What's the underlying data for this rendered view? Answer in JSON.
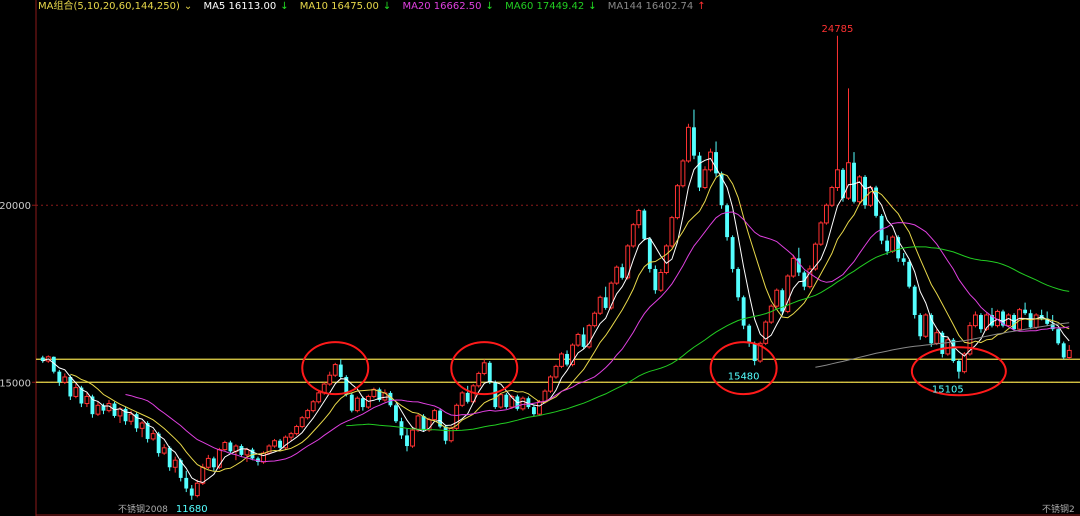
{
  "legend": {
    "group_label": "MA组合(5,10,20,60,144,250)",
    "group_arrow": "⌄",
    "items": [
      {
        "label": "MA5 16113.00",
        "arrow": "↓",
        "color": "#ffffff"
      },
      {
        "label": "MA10 16475.00",
        "arrow": "↓",
        "color": "#e8d84a"
      },
      {
        "label": "MA20 16662.50",
        "arrow": "↓",
        "color": "#e040e0"
      },
      {
        "label": "MA60 17449.42",
        "arrow": "↓",
        "color": "#22cc22"
      },
      {
        "label": "MA144 16402.74",
        "arrow": "↑",
        "color": "#888888"
      }
    ],
    "group_color": "#e8d84a",
    "down_color": "#22dd22",
    "up_color": "#ff3030"
  },
  "colors": {
    "up": "#ff3232",
    "down": "#54ffff",
    "ma5": "#ffffff",
    "ma10": "#e8d84a",
    "ma20": "#e040e0",
    "ma60": "#22cc22",
    "ma144": "#888888",
    "support": "#e8d84a",
    "grid": "#8b1a1a",
    "axis": "#8b1a1a",
    "circle": "#ff1a1a",
    "peak_label": "#ff3232",
    "low_label": "#54ffff"
  },
  "chart_data": {
    "type": "candlestick",
    "y_ticks": [
      15000,
      20000
    ],
    "ylim": [
      11450,
      25400
    ],
    "support_levels": [
      15000,
      15650
    ],
    "annotations": [
      {
        "text": "24785",
        "value": 24785,
        "index": 144,
        "kind": "peak"
      },
      {
        "text": "15480",
        "value": 15480,
        "index": 127,
        "kind": "low"
      },
      {
        "text": "15105",
        "value": 15105,
        "index": 164,
        "kind": "low"
      },
      {
        "text": "11680",
        "value": 11680,
        "index": 27,
        "kind": "low"
      }
    ],
    "circles": [
      {
        "index": 53,
        "value": 15400
      },
      {
        "index": 80,
        "value": 15400
      },
      {
        "index": 127,
        "value": 15400
      },
      {
        "index": 166,
        "value": 15310
      }
    ],
    "bottom_labels": [
      "不锈钢2008",
      "不锈钢2"
    ],
    "ma_labels": [
      "MA5",
      "MA10",
      "MA20",
      "MA60",
      "MA144"
    ],
    "candles": [
      [
        15700,
        15750,
        15550,
        15600
      ],
      [
        15600,
        15760,
        15550,
        15720
      ],
      [
        15720,
        15730,
        15250,
        15300
      ],
      [
        15300,
        15350,
        14900,
        15000
      ],
      [
        15000,
        15250,
        14950,
        15150
      ],
      [
        15150,
        15200,
        14500,
        14600
      ],
      [
        14600,
        14950,
        14550,
        14850
      ],
      [
        14850,
        14900,
        14300,
        14400
      ],
      [
        14400,
        14700,
        14300,
        14600
      ],
      [
        14600,
        14650,
        14000,
        14100
      ],
      [
        14100,
        14450,
        14050,
        14350
      ],
      [
        14350,
        14400,
        14100,
        14200
      ],
      [
        14200,
        14500,
        14150,
        14400
      ],
      [
        14400,
        14450,
        14000,
        14050
      ],
      [
        14050,
        14300,
        13850,
        14250
      ],
      [
        14250,
        14300,
        13800,
        13900
      ],
      [
        13900,
        14200,
        13800,
        14100
      ],
      [
        14100,
        14150,
        13600,
        13700
      ],
      [
        13700,
        13900,
        13450,
        13850
      ],
      [
        13850,
        13900,
        13300,
        13400
      ],
      [
        13400,
        13650,
        13350,
        13550
      ],
      [
        13550,
        13600,
        12900,
        13000
      ],
      [
        13000,
        13250,
        12950,
        13150
      ],
      [
        13150,
        13200,
        12500,
        12600
      ],
      [
        12600,
        12900,
        12450,
        12800
      ],
      [
        12800,
        12850,
        12200,
        12300
      ],
      [
        12300,
        12500,
        11900,
        12000
      ],
      [
        12000,
        12100,
        11680,
        11800
      ],
      [
        11800,
        12250,
        11750,
        12150
      ],
      [
        12150,
        12700,
        12100,
        12600
      ],
      [
        12600,
        12950,
        12550,
        12850
      ],
      [
        12850,
        12900,
        12500,
        12600
      ],
      [
        12600,
        13150,
        12550,
        13100
      ],
      [
        13100,
        13350,
        13050,
        13300
      ],
      [
        13300,
        13350,
        13000,
        13050
      ],
      [
        13050,
        13250,
        12800,
        13200
      ],
      [
        13200,
        13250,
        12900,
        12950
      ],
      [
        12950,
        13150,
        12750,
        13100
      ],
      [
        13100,
        13150,
        12800,
        12850
      ],
      [
        12850,
        12900,
        12650,
        12750
      ],
      [
        12750,
        13050,
        12700,
        13000
      ],
      [
        13000,
        13250,
        12950,
        13200
      ],
      [
        13200,
        13400,
        13150,
        13350
      ],
      [
        13350,
        13400,
        13100,
        13150
      ],
      [
        13150,
        13500,
        13100,
        13450
      ],
      [
        13450,
        13600,
        13350,
        13550
      ],
      [
        13550,
        13800,
        13500,
        13750
      ],
      [
        13750,
        14050,
        13700,
        14000
      ],
      [
        14000,
        14250,
        13950,
        14200
      ],
      [
        14200,
        14500,
        14150,
        14450
      ],
      [
        14450,
        14750,
        14400,
        14700
      ],
      [
        14700,
        15000,
        14650,
        14950
      ],
      [
        14950,
        15300,
        14900,
        15200
      ],
      [
        15200,
        15550,
        15150,
        15500
      ],
      [
        15500,
        15650,
        15100,
        15150
      ],
      [
        15150,
        15200,
        14600,
        14650
      ],
      [
        14650,
        14700,
        14150,
        14200
      ],
      [
        14200,
        14600,
        14150,
        14550
      ],
      [
        14550,
        14600,
        14200,
        14300
      ],
      [
        14300,
        14650,
        14250,
        14600
      ],
      [
        14600,
        14850,
        14550,
        14800
      ],
      [
        14800,
        14850,
        14450,
        14500
      ],
      [
        14500,
        14800,
        14450,
        14700
      ],
      [
        14700,
        14750,
        14300,
        14350
      ],
      [
        14350,
        14400,
        13850,
        13900
      ],
      [
        13900,
        14000,
        13400,
        13500
      ],
      [
        13500,
        13700,
        13050,
        13200
      ],
      [
        13200,
        13750,
        13150,
        13650
      ],
      [
        13650,
        14100,
        13600,
        14050
      ],
      [
        14050,
        14100,
        13600,
        13650
      ],
      [
        13650,
        14000,
        13600,
        13950
      ],
      [
        13950,
        14250,
        13900,
        14200
      ],
      [
        14200,
        14250,
        13700,
        13750
      ],
      [
        13750,
        13800,
        13250,
        13350
      ],
      [
        13350,
        13750,
        13300,
        13700
      ],
      [
        13700,
        14400,
        13650,
        14350
      ],
      [
        14350,
        14750,
        14300,
        14700
      ],
      [
        14700,
        14900,
        14400,
        14450
      ],
      [
        14450,
        14950,
        14400,
        14900
      ],
      [
        14900,
        15300,
        14850,
        15250
      ],
      [
        15250,
        15650,
        15200,
        15550
      ],
      [
        15550,
        15600,
        14950,
        15000
      ],
      [
        15000,
        15050,
        14250,
        14300
      ],
      [
        14300,
        14700,
        14250,
        14650
      ],
      [
        14650,
        14700,
        14250,
        14300
      ],
      [
        14300,
        14650,
        14250,
        14600
      ],
      [
        14600,
        14650,
        14200,
        14250
      ],
      [
        14250,
        14600,
        14200,
        14550
      ],
      [
        14550,
        14600,
        14250,
        14300
      ],
      [
        14300,
        14350,
        14050,
        14100
      ],
      [
        14100,
        14500,
        14050,
        14450
      ],
      [
        14450,
        14800,
        14400,
        14750
      ],
      [
        14750,
        15200,
        14700,
        15150
      ],
      [
        15150,
        15500,
        15100,
        15450
      ],
      [
        15450,
        15850,
        15400,
        15800
      ],
      [
        15800,
        15900,
        15450,
        15500
      ],
      [
        15500,
        16100,
        15450,
        16050
      ],
      [
        16050,
        16400,
        16000,
        16350
      ],
      [
        16350,
        16550,
        15950,
        16000
      ],
      [
        16000,
        16650,
        15950,
        16600
      ],
      [
        16600,
        17000,
        16550,
        16950
      ],
      [
        16950,
        17450,
        16900,
        17400
      ],
      [
        17400,
        17700,
        17050,
        17100
      ],
      [
        17100,
        17850,
        17050,
        17800
      ],
      [
        17800,
        18300,
        17750,
        18250
      ],
      [
        18250,
        18350,
        17900,
        17950
      ],
      [
        17950,
        18900,
        17900,
        18850
      ],
      [
        18850,
        19500,
        18800,
        19450
      ],
      [
        19450,
        19900,
        19350,
        19850
      ],
      [
        19850,
        19900,
        19000,
        19050
      ],
      [
        19050,
        19100,
        18100,
        18200
      ],
      [
        18200,
        18300,
        17500,
        17600
      ],
      [
        17600,
        18200,
        17550,
        18100
      ],
      [
        18100,
        18900,
        18050,
        18850
      ],
      [
        18850,
        19700,
        18800,
        19650
      ],
      [
        19650,
        20600,
        19600,
        20550
      ],
      [
        20550,
        21300,
        20500,
        21250
      ],
      [
        21250,
        22300,
        21200,
        22200
      ],
      [
        22200,
        22700,
        21300,
        21400
      ],
      [
        21400,
        21500,
        20400,
        20500
      ],
      [
        20500,
        21100,
        20450,
        21000
      ],
      [
        21000,
        21600,
        20950,
        21500
      ],
      [
        21500,
        21800,
        20800,
        20900
      ],
      [
        20900,
        20950,
        19900,
        20000
      ],
      [
        20000,
        20050,
        19000,
        19100
      ],
      [
        19100,
        19150,
        18100,
        18200
      ],
      [
        18200,
        18250,
        17300,
        17400
      ],
      [
        17400,
        17450,
        16500,
        16600
      ],
      [
        16600,
        16650,
        16000,
        16100
      ],
      [
        16100,
        16150,
        15480,
        15600
      ],
      [
        15600,
        16150,
        15550,
        16100
      ],
      [
        16100,
        16750,
        16050,
        16700
      ],
      [
        16700,
        17200,
        16650,
        17150
      ],
      [
        17150,
        17650,
        17100,
        17600
      ],
      [
        17600,
        17650,
        16900,
        17000
      ],
      [
        17000,
        18050,
        16950,
        18000
      ],
      [
        18000,
        18600,
        17950,
        18500
      ],
      [
        18500,
        18800,
        18000,
        18100
      ],
      [
        18100,
        18150,
        17600,
        17700
      ],
      [
        17700,
        18300,
        17650,
        18200
      ],
      [
        18200,
        18950,
        18150,
        18900
      ],
      [
        18900,
        19550,
        18850,
        19500
      ],
      [
        19500,
        20050,
        19450,
        20000
      ],
      [
        20000,
        20550,
        19950,
        20500
      ],
      [
        20500,
        24785,
        20400,
        21000
      ],
      [
        21000,
        21050,
        20100,
        20200
      ],
      [
        20200,
        23300,
        20150,
        21200
      ],
      [
        21200,
        21500,
        20050,
        20100
      ],
      [
        20100,
        20850,
        20050,
        20800
      ],
      [
        20800,
        20850,
        19900,
        20000
      ],
      [
        20000,
        20550,
        19950,
        20500
      ],
      [
        20500,
        20550,
        19650,
        19700
      ],
      [
        19700,
        19750,
        18900,
        19000
      ],
      [
        19000,
        19150,
        18600,
        18700
      ],
      [
        18700,
        19150,
        18650,
        19100
      ],
      [
        19100,
        19150,
        18400,
        18500
      ],
      [
        18500,
        18650,
        18300,
        18400
      ],
      [
        18400,
        18450,
        17650,
        17700
      ],
      [
        17700,
        17750,
        16800,
        16900
      ],
      [
        16900,
        16950,
        16200,
        16300
      ],
      [
        16300,
        16950,
        16250,
        16900
      ],
      [
        16900,
        16950,
        16000,
        16100
      ],
      [
        16100,
        16500,
        16050,
        16400
      ],
      [
        16400,
        16450,
        15700,
        15800
      ],
      [
        15800,
        16250,
        15750,
        16200
      ],
      [
        16200,
        16250,
        15550,
        15600
      ],
      [
        15600,
        15650,
        15105,
        15300
      ],
      [
        15300,
        15850,
        15250,
        15800
      ],
      [
        15800,
        16700,
        15750,
        16600
      ],
      [
        16600,
        17000,
        16550,
        16900
      ],
      [
        16900,
        16950,
        16400,
        16500
      ],
      [
        16500,
        16950,
        16450,
        16900
      ],
      [
        16900,
        17100,
        16550,
        16600
      ],
      [
        16600,
        17050,
        16550,
        17000
      ],
      [
        17000,
        17050,
        16550,
        16600
      ],
      [
        16600,
        16950,
        16550,
        16900
      ],
      [
        16900,
        16950,
        16450,
        16500
      ],
      [
        16500,
        17100,
        16450,
        17050
      ],
      [
        17050,
        17250,
        16900,
        16950
      ],
      [
        16950,
        17050,
        16500,
        16550
      ],
      [
        16550,
        16950,
        16500,
        16900
      ],
      [
        16900,
        17050,
        16750,
        16800
      ],
      [
        16800,
        17000,
        16600,
        16650
      ],
      [
        16650,
        16900,
        16450,
        16500
      ],
      [
        16500,
        16550,
        16050,
        16100
      ],
      [
        16100,
        16150,
        15650,
        15700
      ],
      [
        15700,
        16050,
        15650,
        15900
      ]
    ]
  }
}
